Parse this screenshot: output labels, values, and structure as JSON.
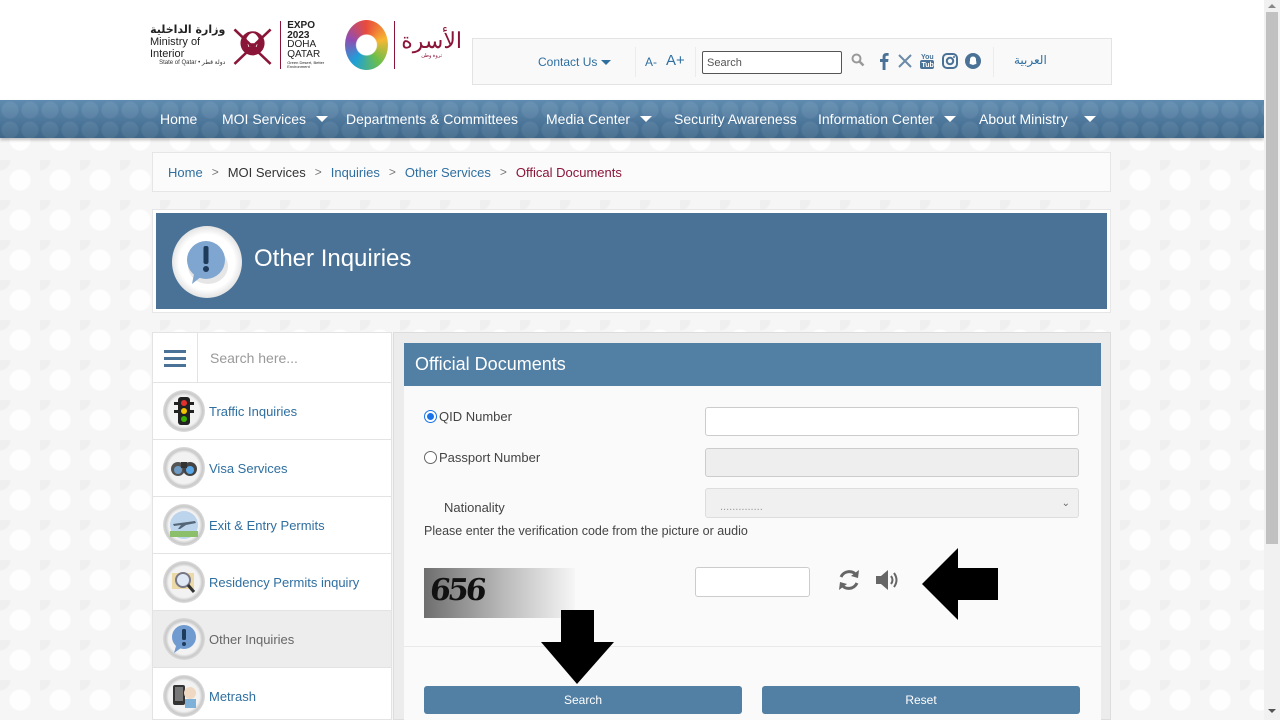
{
  "header": {
    "logo": {
      "ministry_ar": "وزارة الداخلية",
      "ministry_en": "Ministry of Interior",
      "state": "State of Qatar • دولة قطر",
      "expo_line1": "EXPO",
      "expo_line2": "2023",
      "expo_line3": "DOHA",
      "expo_line4": "QATAR",
      "expo_tagline": "Green Desert, Better Environment",
      "calligraphy_ar": "الأسرة",
      "calligraphy_sub": "ثروة وطن"
    },
    "utility": {
      "contact_us": "Contact Us",
      "font_decrease": "A-",
      "font_increase": "A+",
      "search_placeholder": "Search",
      "language": "العربية",
      "social": [
        "facebook",
        "x-twitter",
        "youtube",
        "instagram",
        "snapchat"
      ]
    }
  },
  "nav": {
    "items": [
      {
        "label": "Home",
        "dropdown": false
      },
      {
        "label": "MOI Services",
        "dropdown": true
      },
      {
        "label": "Departments & Committees",
        "dropdown": false
      },
      {
        "label": "Media Center",
        "dropdown": true
      },
      {
        "label": "Security Awareness",
        "dropdown": false
      },
      {
        "label": "Information Center",
        "dropdown": true
      },
      {
        "label": "About Ministry",
        "dropdown": true
      }
    ]
  },
  "breadcrumb": {
    "items": [
      "Home",
      "MOI Services",
      "Inquiries",
      "Other Services"
    ],
    "separator": ">",
    "current": "Offical Documents"
  },
  "page_title": "Other Inquiries",
  "sidebar": {
    "search_placeholder": "Search here...",
    "items": [
      {
        "label": "Traffic Inquiries",
        "icon": "traffic-light-icon",
        "active": false
      },
      {
        "label": "Visa Services",
        "icon": "binoculars-icon",
        "active": false
      },
      {
        "label": "Exit & Entry Permits",
        "icon": "airplane-icon",
        "active": false
      },
      {
        "label": "Residency Permits inquiry",
        "icon": "magnifier-document-icon",
        "active": false
      },
      {
        "label": "Other Inquiries",
        "icon": "exclamation-bubble-icon",
        "active": true
      },
      {
        "label": "Metrash",
        "icon": "metrash-phone-icon",
        "active": false
      }
    ]
  },
  "form": {
    "title": "Official Documents",
    "qid_label": "QID Number",
    "qid_selected": true,
    "qid_value": "",
    "passport_label": "Passport Number",
    "passport_selected": false,
    "passport_value": "",
    "nationality_label": "Nationality",
    "nationality_value": "..............",
    "verify_text": "Please enter the verification code from the picture or audio",
    "captcha_code": "656",
    "captcha_input": "",
    "search_button": "Search",
    "reset_button": "Reset"
  },
  "colors": {
    "brand_blue": "#4a7296",
    "nav_blue": "#527fa4",
    "link_blue": "#2f6fa0",
    "maroon": "#8a1538",
    "radio_blue": "#1a73e8"
  }
}
